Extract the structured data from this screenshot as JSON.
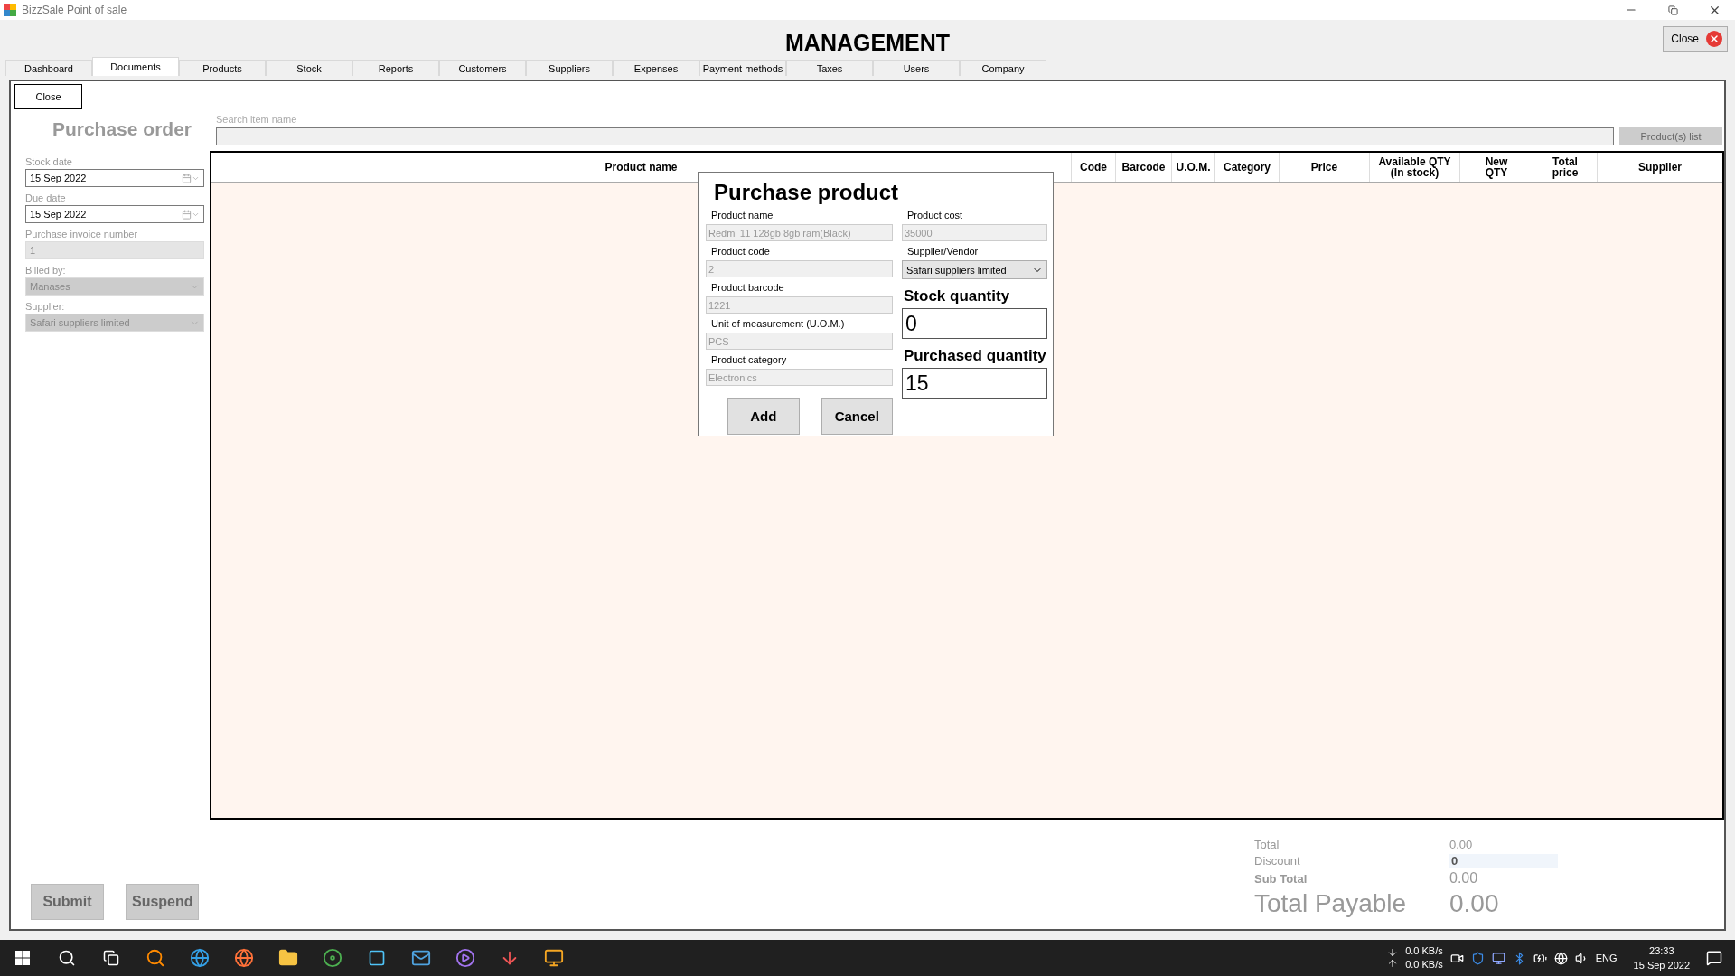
{
  "window": {
    "title": "BizzSale Point of sale"
  },
  "header": {
    "title": "MANAGEMENT",
    "close_button": "Close"
  },
  "tabs": [
    {
      "label": "Dashboard",
      "selected": false
    },
    {
      "label": "Documents",
      "selected": true
    },
    {
      "label": "Products",
      "selected": false
    },
    {
      "label": "Stock",
      "selected": false
    },
    {
      "label": "Reports",
      "selected": false
    },
    {
      "label": "Customers",
      "selected": false
    },
    {
      "label": "Suppliers",
      "selected": false
    },
    {
      "label": "Expenses",
      "selected": false
    },
    {
      "label": "Payment methods",
      "selected": false
    },
    {
      "label": "Taxes",
      "selected": false
    },
    {
      "label": "Users",
      "selected": false
    },
    {
      "label": "Company",
      "selected": false
    }
  ],
  "panel": {
    "close_button": "Close",
    "title": "Purchase order",
    "fields": [
      {
        "kind": "date",
        "label": "Stock date",
        "value": "15 Sep 2022"
      },
      {
        "kind": "date",
        "label": "Due date",
        "value": "15 Sep 2022"
      },
      {
        "kind": "text",
        "label": "Purchase invoice number",
        "value": "1"
      },
      {
        "kind": "select",
        "label": "Billed by:",
        "value": "Manases"
      },
      {
        "kind": "select",
        "label": "Supplier:",
        "value": "Safari suppliers limited"
      }
    ],
    "search": {
      "label": "Search item name"
    },
    "products_button": "Product(s) list",
    "table": {
      "columns": [
        "Product name",
        "Code",
        "Barcode",
        "U.O.M.",
        "Category",
        "Price",
        "Available QTY\n(In stock)",
        "New\nQTY",
        "Total\nprice",
        "Supplier"
      ]
    },
    "buttons": [
      "Submit",
      "Suspend"
    ],
    "totals": {
      "total_label": "Total",
      "total_value": "0.00",
      "discount_label": "Discount",
      "discount_value": "0",
      "subtotal_label": "Sub Total",
      "subtotal_value": "0.00",
      "payable_label": "Total Payable",
      "payable_value": "0.00"
    }
  },
  "dialog": {
    "title": "Purchase product",
    "left_fields": [
      {
        "label": "Product name",
        "value": "Redmi 11 128gb 8gb ram(Black)"
      },
      {
        "label": "Product code",
        "value": "2"
      },
      {
        "label": "Product barcode",
        "value": "1221"
      },
      {
        "label": "Unit of measurement (U.O.M.)",
        "value": "PCS"
      },
      {
        "label": "Product category",
        "value": "Electronics"
      }
    ],
    "cost": {
      "label": "Product cost",
      "value": "35000"
    },
    "supplier": {
      "label": "Supplier/Vendor",
      "value": "Safari suppliers limited"
    },
    "stock_quantity": {
      "label": "Stock quantity",
      "value": "0"
    },
    "purchased_quantity": {
      "label": "Purchased quantity",
      "value": "15"
    },
    "buttons": [
      "Add",
      "Cancel"
    ]
  },
  "taskbar": {
    "net_down": "0.0 KB/s",
    "net_up": "0.0 KB/s",
    "language": "ENG",
    "time": "23:33",
    "date": "15 Sep 2022"
  }
}
